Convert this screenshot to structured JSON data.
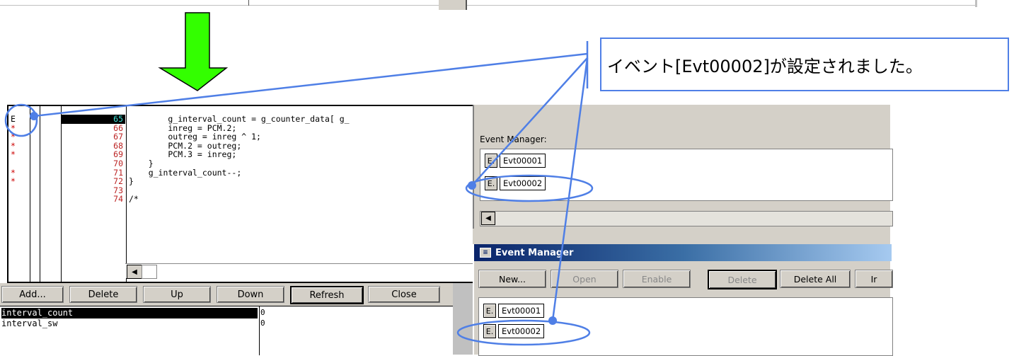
{
  "callout": {
    "message": "イベント[Evt00002]が設定されました。"
  },
  "colors": {
    "arrow": "#33ff00",
    "highlight": "#4f7fe6"
  },
  "source": {
    "lines": [
      {
        "num": "65",
        "flag": "E",
        "code": "        g_interval_count = g_counter_data[ g_",
        "current": true
      },
      {
        "num": "66",
        "flag": "*",
        "code": "        inreg = PCM.2;"
      },
      {
        "num": "67",
        "flag": "*",
        "code": "        outreg = inreg ^ 1;"
      },
      {
        "num": "68",
        "flag": "*",
        "code": "        PCM.2 = outreg;"
      },
      {
        "num": "69",
        "flag": "*",
        "code": "        PCM.3 = inreg;"
      },
      {
        "num": "70",
        "flag": "",
        "code": "    }"
      },
      {
        "num": "71",
        "flag": "*",
        "code": "    g_interval_count--;"
      },
      {
        "num": "72",
        "flag": "*",
        "code": "}"
      },
      {
        "num": "73",
        "flag": "",
        "code": ""
      },
      {
        "num": "74",
        "flag": "",
        "code": "/*"
      }
    ]
  },
  "watch": {
    "buttons": [
      "Add...",
      "Delete",
      "Up",
      "Down",
      "Refresh",
      "Close"
    ],
    "items": [
      {
        "name": "interval_count",
        "value": "0"
      },
      {
        "name": "interval_sw",
        "value": "0"
      }
    ]
  },
  "event_manager_pane": {
    "label": "Event Manager:",
    "items": [
      {
        "flag": "E.",
        "name": "Evt00001"
      },
      {
        "flag": "E.",
        "name": "Evt00002"
      }
    ]
  },
  "event_manager_window": {
    "title": "Event Manager",
    "toolbar": [
      "New...",
      "Open",
      "Enable",
      "Delete",
      "Delete All",
      "Ir"
    ],
    "items": [
      {
        "flag": "E.",
        "name": "Evt00001"
      },
      {
        "flag": "E.",
        "name": "Evt00002"
      }
    ]
  }
}
